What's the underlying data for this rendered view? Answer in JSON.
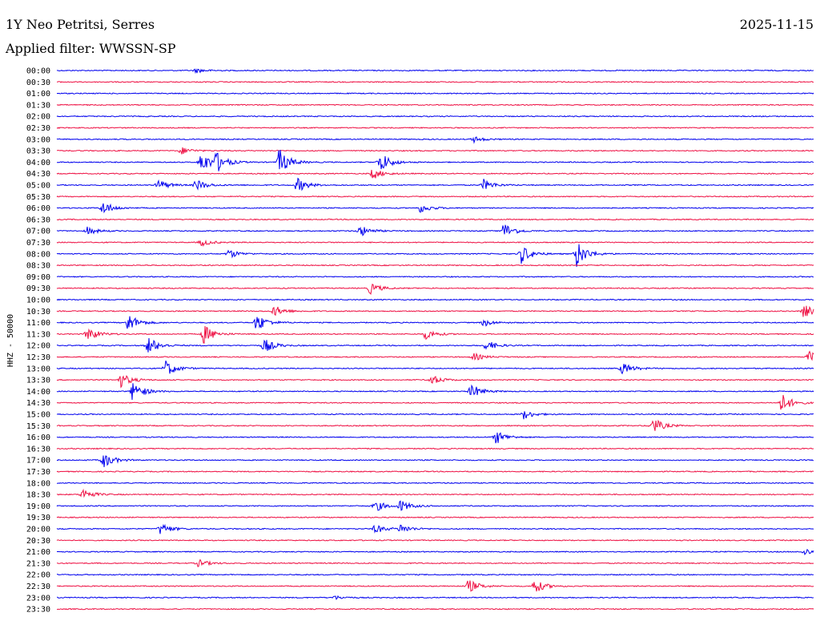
{
  "header": {
    "station": "1Y Neo Petritsi, Serres",
    "date": "2025-11-15",
    "filter": "Applied filter: WWSSN-SP"
  },
  "colors": {
    "primary": "#0000ee",
    "alternate": "#ee1144",
    "background": "#ffffff",
    "text": "#000000"
  },
  "chart_data": {
    "type": "line",
    "ylabel": "HHZ - 50000",
    "xlabel": "",
    "title": "",
    "x_range_minutes": [
      0,
      30
    ],
    "legend": "none",
    "grid": false,
    "tick_labels": [
      "00:00",
      "00:30",
      "01:00",
      "01:30",
      "02:00",
      "02:30",
      "03:00",
      "03:30",
      "04:00",
      "04:30",
      "05:00",
      "05:30",
      "06:00",
      "06:30",
      "07:00",
      "07:30",
      "08:00",
      "08:30",
      "09:00",
      "09:30",
      "10:00",
      "10:30",
      "11:00",
      "11:30",
      "12:00",
      "12:30",
      "13:00",
      "13:30",
      "14:00",
      "14:30",
      "15:00",
      "15:30",
      "16:00",
      "16:30",
      "17:00",
      "17:30",
      "18:00",
      "18:30",
      "19:00",
      "19:30",
      "20:00",
      "20:30",
      "21:00",
      "21:30",
      "22:00",
      "22:30",
      "23:00",
      "23:30"
    ],
    "note_units": "event minute within row, relative amplitude",
    "events": [
      {
        "row": 0,
        "minute": 5.5,
        "amp": 0.6
      },
      {
        "row": 6,
        "minute": 16.5,
        "amp": 0.8
      },
      {
        "row": 7,
        "minute": 4.9,
        "amp": 1.0
      },
      {
        "row": 8,
        "minute": 5.7,
        "amp": 3.0
      },
      {
        "row": 8,
        "minute": 6.3,
        "amp": 2.4
      },
      {
        "row": 8,
        "minute": 8.8,
        "amp": 3.5
      },
      {
        "row": 8,
        "minute": 12.8,
        "amp": 2.8
      },
      {
        "row": 9,
        "minute": 12.5,
        "amp": 1.5
      },
      {
        "row": 10,
        "minute": 4.0,
        "amp": 1.5
      },
      {
        "row": 10,
        "minute": 5.5,
        "amp": 1.6
      },
      {
        "row": 10,
        "minute": 9.5,
        "amp": 2.0
      },
      {
        "row": 10,
        "minute": 16.9,
        "amp": 1.5
      },
      {
        "row": 12,
        "minute": 1.8,
        "amp": 1.8
      },
      {
        "row": 12,
        "minute": 14.4,
        "amp": 1.2
      },
      {
        "row": 14,
        "minute": 1.2,
        "amp": 1.0
      },
      {
        "row": 14,
        "minute": 12.0,
        "amp": 1.5
      },
      {
        "row": 14,
        "minute": 17.7,
        "amp": 2.2
      },
      {
        "row": 15,
        "minute": 5.7,
        "amp": 1.0
      },
      {
        "row": 16,
        "minute": 6.8,
        "amp": 1.2
      },
      {
        "row": 16,
        "minute": 18.4,
        "amp": 2.5
      },
      {
        "row": 16,
        "minute": 20.6,
        "amp": 3.5
      },
      {
        "row": 19,
        "minute": 12.4,
        "amp": 1.5
      },
      {
        "row": 21,
        "minute": 8.6,
        "amp": 1.5
      },
      {
        "row": 21,
        "minute": 29.6,
        "amp": 1.8
      },
      {
        "row": 22,
        "minute": 2.8,
        "amp": 2.5
      },
      {
        "row": 22,
        "minute": 7.9,
        "amp": 2.5
      },
      {
        "row": 22,
        "minute": 16.9,
        "amp": 1.0
      },
      {
        "row": 23,
        "minute": 1.2,
        "amp": 2.0
      },
      {
        "row": 23,
        "minute": 5.8,
        "amp": 2.6
      },
      {
        "row": 23,
        "minute": 14.6,
        "amp": 1.4
      },
      {
        "row": 24,
        "minute": 3.6,
        "amp": 2.5
      },
      {
        "row": 24,
        "minute": 8.2,
        "amp": 2.0
      },
      {
        "row": 24,
        "minute": 17.0,
        "amp": 1.4
      },
      {
        "row": 25,
        "minute": 16.5,
        "amp": 1.0
      },
      {
        "row": 25,
        "minute": 29.8,
        "amp": 1.5
      },
      {
        "row": 26,
        "minute": 4.3,
        "amp": 2.2
      },
      {
        "row": 26,
        "minute": 22.4,
        "amp": 1.6
      },
      {
        "row": 27,
        "minute": 2.5,
        "amp": 2.0
      },
      {
        "row": 27,
        "minute": 14.8,
        "amp": 1.4
      },
      {
        "row": 28,
        "minute": 3.0,
        "amp": 2.8
      },
      {
        "row": 28,
        "minute": 16.4,
        "amp": 2.0
      },
      {
        "row": 29,
        "minute": 28.7,
        "amp": 2.6
      },
      {
        "row": 30,
        "minute": 18.5,
        "amp": 1.2
      },
      {
        "row": 31,
        "minute": 23.6,
        "amp": 2.2
      },
      {
        "row": 32,
        "minute": 17.4,
        "amp": 1.8
      },
      {
        "row": 34,
        "minute": 1.8,
        "amp": 2.2
      },
      {
        "row": 37,
        "minute": 1.0,
        "amp": 1.6
      },
      {
        "row": 38,
        "minute": 12.6,
        "amp": 1.5
      },
      {
        "row": 38,
        "minute": 13.6,
        "amp": 1.5
      },
      {
        "row": 40,
        "minute": 4.1,
        "amp": 1.6
      },
      {
        "row": 40,
        "minute": 12.6,
        "amp": 1.2
      },
      {
        "row": 40,
        "minute": 13.6,
        "amp": 1.2
      },
      {
        "row": 42,
        "minute": 29.6,
        "amp": 1.0
      },
      {
        "row": 43,
        "minute": 5.6,
        "amp": 1.0
      },
      {
        "row": 45,
        "minute": 16.3,
        "amp": 1.8
      },
      {
        "row": 45,
        "minute": 18.9,
        "amp": 2.0
      },
      {
        "row": 46,
        "minute": 11.0,
        "amp": 0.5
      }
    ]
  }
}
